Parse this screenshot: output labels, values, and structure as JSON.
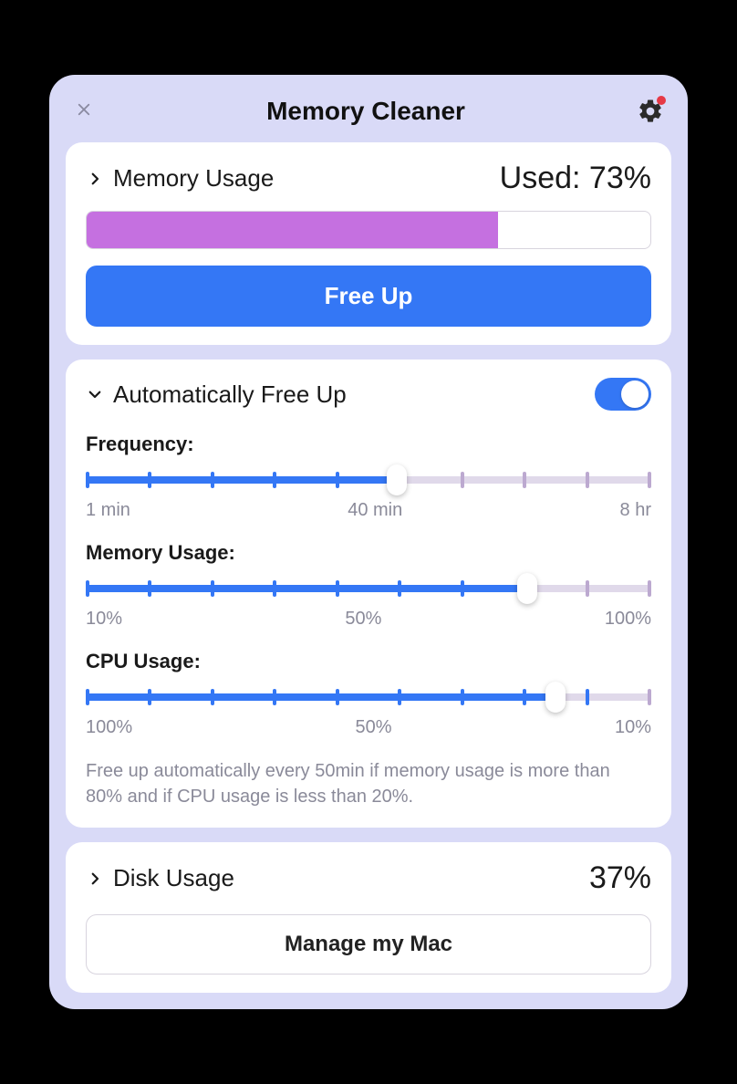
{
  "window": {
    "title": "Memory Cleaner"
  },
  "memory": {
    "section_title": "Memory Usage",
    "used_label": "Used: 73%",
    "used_percent": 73,
    "free_up_button": "Free Up"
  },
  "auto": {
    "section_title": "Automatically Free Up",
    "toggle_on": true,
    "frequency": {
      "label": "Frequency:",
      "min_label": "1 min",
      "mid_label": "40 min",
      "max_label": "8 hr",
      "percent": 55,
      "ticks_total": 10,
      "ticks_active": 6
    },
    "mem_usage": {
      "label": "Memory Usage:",
      "min_label": "10%",
      "mid_label": "50%",
      "max_label": "100%",
      "percent": 78,
      "ticks_total": 10,
      "ticks_active": 8
    },
    "cpu_usage": {
      "label": "CPU Usage:",
      "min_label": "100%",
      "mid_label": "50%",
      "max_label": "10%",
      "percent": 83,
      "ticks_total": 10,
      "ticks_active": 9
    },
    "summary": "Free up automatically every 50min if memory usage is more than 80% and if CPU usage is less than 20%."
  },
  "disk": {
    "section_title": "Disk Usage",
    "value": "37%",
    "manage_button": "Manage my Mac"
  }
}
